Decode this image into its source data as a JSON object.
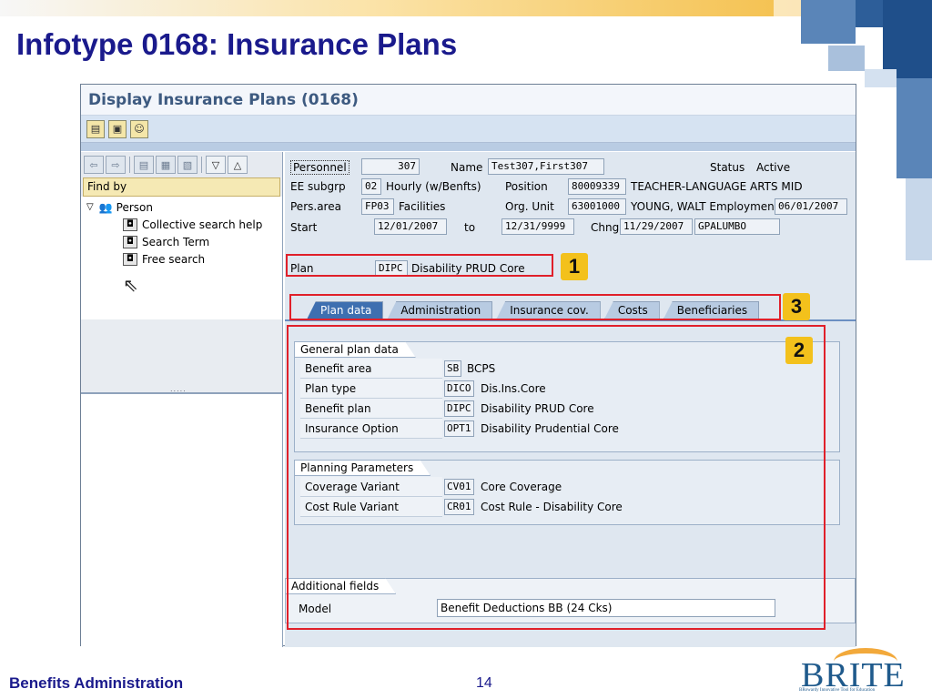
{
  "slide": {
    "title": "Infotype 0168: Insurance Plans",
    "footer_left": "Benefits Administration",
    "page_number": "14",
    "logo_text": "BRITE",
    "logo_tagline": "BRowardy Innovative Tool for Education"
  },
  "window": {
    "title": "Display Insurance Plans (0168)",
    "toolbar_icons": [
      "doc-icon",
      "doc-icon",
      "person-icon"
    ]
  },
  "nav": {
    "find_by": "Find by",
    "tree": {
      "root": "Person",
      "items": [
        "Collective search help",
        "Search Term",
        "Free search"
      ]
    },
    "grip": "....."
  },
  "header": {
    "personnel_label": "Personnel",
    "personnel_value": "307",
    "name_label": "Name",
    "name_value": "Test307,First307",
    "status_label": "Status",
    "status_value": "Active",
    "ee_subgrp_label": "EE subgrp",
    "ee_subgrp_code": "02",
    "ee_subgrp_text": "Hourly  (w/Benfts)",
    "position_label": "Position",
    "position_code": "80009339",
    "position_text": "TEACHER-LANGUAGE ARTS MID",
    "pers_area_label": "Pers.area",
    "pers_area_code": "FP03",
    "pers_area_text": "Facilities",
    "org_unit_label": "Org. Unit",
    "org_unit_code": "63001000",
    "org_unit_text": "YOUNG, WALT Employmen",
    "org_unit_date": "06/01/2007",
    "start_label": "Start",
    "start_value": "12/01/2007",
    "to_label": "to",
    "to_value": "12/31/9999",
    "chng_label": "Chng",
    "chng_date": "11/29/2007",
    "chng_user": "GPALUMBO",
    "plan_label": "Plan",
    "plan_code": "DIPC",
    "plan_text": "Disability PRUD Core"
  },
  "tabs": [
    "Plan data",
    "Administration",
    "Insurance cov.",
    "Costs",
    "Beneficiaries"
  ],
  "general_plan_data": {
    "title": "General plan data",
    "rows": [
      {
        "label": "Benefit area",
        "code": "SB",
        "desc": "BCPS"
      },
      {
        "label": "Plan type",
        "code": "DICO",
        "desc": "Dis.Ins.Core"
      },
      {
        "label": "Benefit plan",
        "code": "DIPC",
        "desc": "Disability PRUD Core"
      },
      {
        "label": "Insurance Option",
        "code": "OPT1",
        "desc": "Disability Prudential Core"
      }
    ]
  },
  "planning_parameters": {
    "title": "Planning Parameters",
    "rows": [
      {
        "label": "Coverage Variant",
        "code": "CV01",
        "desc": "Core Coverage"
      },
      {
        "label": "Cost Rule Variant",
        "code": "CR01",
        "desc": "Cost Rule - Disability Core"
      }
    ]
  },
  "additional_fields": {
    "title": "Additional fields",
    "model_label": "Model",
    "model_value": "Benefit Deductions BB (24 Cks)"
  },
  "badges": [
    "1",
    "2",
    "3"
  ],
  "colors": {
    "title_blue": "#1a1a8c",
    "annotation_red": "#e0202a",
    "badge_yellow": "#f3c11c",
    "active_tab": "#3e6fb0"
  }
}
